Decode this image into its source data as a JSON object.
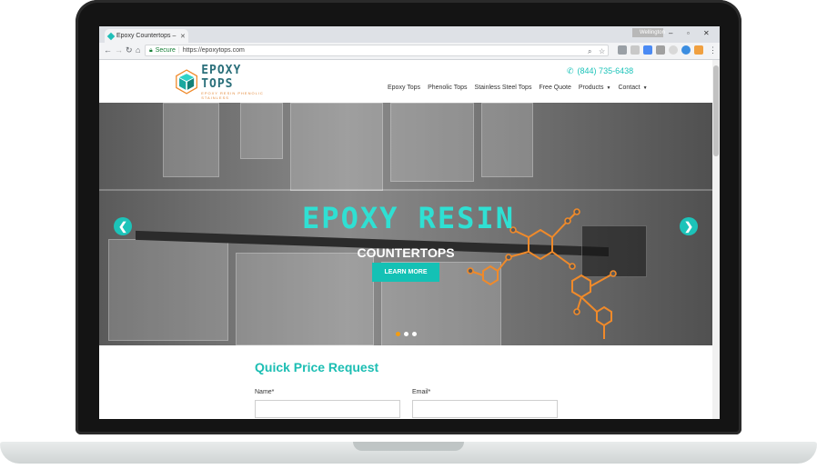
{
  "browser": {
    "tab_title": "Epoxy Countertops – Ch",
    "tab_close": "✕",
    "user_label": "Wellington",
    "secure_label": "Secure",
    "url": "https://epoxytops.com"
  },
  "site": {
    "logo_name": "EPOXY TOPS",
    "logo_tagline": "EPOXY RESIN  PHENOLIC  STAINLESS",
    "phone": "(844) 735-6438",
    "nav": [
      "Epoxy Tops",
      "Phenolic Tops",
      "Stainless Steel Tops",
      "Free Quote",
      "Products",
      "Contact"
    ],
    "colors": {
      "accent": "#1cc3b9",
      "orange": "#f08a2a"
    }
  },
  "hero": {
    "title": "EPOXY RESIN",
    "subtitle": "COUNTERTOPS",
    "button": "LEARN MORE",
    "prev_icon": "❮",
    "next_icon": "❯",
    "slide_count": 3,
    "active_slide": 1
  },
  "form": {
    "title": "Quick Price Request",
    "name_label": "Name*",
    "email_label": "Email*"
  }
}
